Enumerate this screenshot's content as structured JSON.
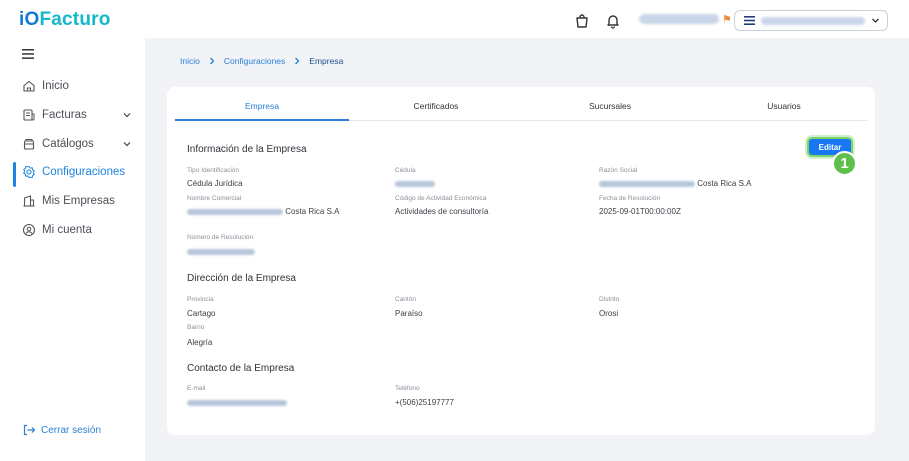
{
  "brand": {
    "logo_prefix": "iO",
    "logo_name": "Facturo",
    "accent": "#1a84e0",
    "logo_color": "#14b8c9"
  },
  "header": {
    "icons": [
      "shopping-bag-icon",
      "bell-icon",
      "flag-icon"
    ],
    "user_name_blurred": "",
    "company_select_blurred": ""
  },
  "sidebar": {
    "items": [
      {
        "label": "Inicio",
        "icon": "home-icon"
      },
      {
        "label": "Facturas",
        "icon": "invoice-icon"
      },
      {
        "label": "Catálogos",
        "icon": "catalog-icon"
      },
      {
        "label": "Configuraciones",
        "icon": "gear-icon"
      },
      {
        "label": "Mis Empresas",
        "icon": "building-icon"
      },
      {
        "label": "Mi cuenta",
        "icon": "user-icon"
      }
    ],
    "logout": "Cerrar sesión"
  },
  "breadcrumb": [
    "Inicio",
    "Configuraciones",
    "Empresa"
  ],
  "tabs": [
    "Empresa",
    "Certificados",
    "Sucursales",
    "Usuarios"
  ],
  "edit_button": "Editar",
  "step_badge": "1",
  "info": {
    "title": "Información de la Empresa",
    "tipo_label": "Tipo Identificación",
    "tipo_value": "Cédula Jurídica",
    "cedula_label": "Cédula",
    "razon_label": "Razón Social",
    "razon_suffix": "Costa Rica S.A",
    "nombre_label": "Nombre Comercial",
    "nombre_suffix": "Costa Rica S.A",
    "actividad_label": "Código de Actividad Económica",
    "actividad_value": "Actividades de consultoría",
    "fecha_label": "Fecha de Resolución",
    "fecha_value": "2025-09-01T00:00:00Z",
    "resolucion_label": "Número de Resolución"
  },
  "address": {
    "title": "Dirección de la Empresa",
    "provincia_label": "Provincia",
    "provincia_value": "Cartago",
    "canton_label": "Cantón",
    "canton_value": "Paraíso",
    "distrito_label": "Distrito",
    "distrito_value": "Orosi",
    "barrio_label": "Barrio",
    "barrio_value": "Alegría"
  },
  "contact": {
    "title": "Contacto de la Empresa",
    "email_label": "E-mail",
    "telefono_label": "Teléfono",
    "telefono_value": "+(506)25197777"
  }
}
